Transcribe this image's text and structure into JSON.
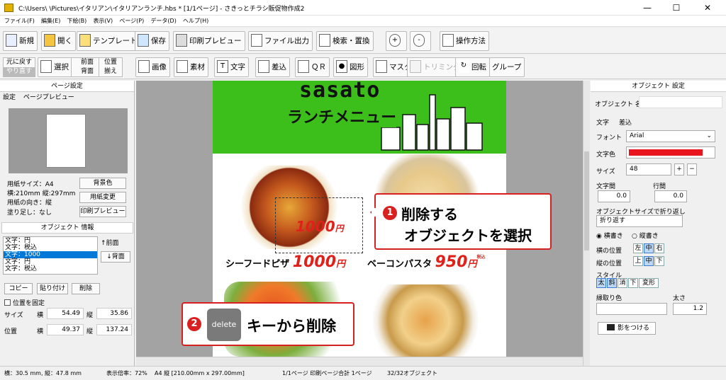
{
  "window": {
    "title": "C:\\Users\\          \\Pictures\\イタリアン\\イタリアンランチ.hbs *  [1/1ページ] - さきっとチラシ販促物作成2"
  },
  "menu": [
    "ファイル(F)",
    "編集(E)",
    "下絵(B)",
    "表示(V)",
    "ページ(P)",
    "データ(D)",
    "ヘルプ(H)"
  ],
  "toolbar1": {
    "new": "新規",
    "open": "開く",
    "template": "テンプレート",
    "save": "保存",
    "print_preview": "印刷プレビュー",
    "file_output": "ファイル出力",
    "search_replace": "検索・置換",
    "zoom_in": "+",
    "zoom_out": "-",
    "help": "操作方法"
  },
  "toolbar2": {
    "undo": "元に戻す",
    "redo": "やり直す",
    "select": "選択",
    "front": "前面",
    "back": "背面",
    "position": "位置",
    "align": "揃え",
    "image": "画像",
    "material": "素材",
    "text": "文字",
    "insert": "差込",
    "qr": "ＱＲ",
    "shape": "図形",
    "mask": "マスク",
    "trim": "トリミング",
    "rotate": "回転",
    "group": "グループ"
  },
  "left": {
    "page_settings": "ページ設定",
    "tab_settings": "設定",
    "tab_preview": "ページプレビュー",
    "paper_size": "用紙サイズ：A4",
    "dims": "横:210mm 縦:297mm",
    "orientation": "用紙の向き：縦",
    "bleed": "塗り足し：なし",
    "bg_color": "背景色",
    "change_paper": "用紙変更",
    "print_preview": "印刷プレビュー",
    "obj_info": "オブジェクト 情報",
    "objects": [
      "文字：円",
      "文字：税込",
      "文字：1000",
      "文字：円",
      "文字：税込"
    ],
    "front": "↑前面",
    "back": "↓背面",
    "copy": "コピー",
    "paste": "貼り付け",
    "delete": "削除",
    "fix_position": "位置を固定",
    "size_label": "サイズ",
    "pos_label": "位置",
    "w_label": "横",
    "h_label": "縦",
    "size_w": "54.49",
    "size_h": "35.86",
    "pos_x": "49.37",
    "pos_y": "137.24"
  },
  "canvas": {
    "brand": "sasato",
    "subtitle": "ランチメニュー",
    "item1": "シーフードピザ",
    "price1": "1000",
    "item2": "ベーコンパスタ",
    "price2": "950",
    "unit": "円",
    "tax": "税込",
    "selected_price": "1000",
    "selected_unit": "円"
  },
  "callouts": {
    "step1_num": "1",
    "step1_line1": "削除する",
    "step1_line2": "オブジェクトを選択",
    "step2_num": "2",
    "step2_key": "delete",
    "step2_text": "キーから削除"
  },
  "right": {
    "header": "オブジェクト 設定",
    "obj_name": "オブジェクト 名",
    "tab_text": "文字",
    "tab_insert": "差込",
    "font_label": "フォント",
    "font_value": "Arial",
    "color_label": "文字色",
    "color_value": "#e8141e",
    "size_label": "サイズ",
    "size_value": "48",
    "char_spacing": "文字間",
    "line_spacing": "行間",
    "char_spacing_val": "0.0",
    "line_spacing_val": "0.0",
    "fit_label": "オブジェクトサイズで折り返し",
    "fit_value": "折り返す",
    "horizontal": "横書き",
    "vertical": "縦書き",
    "h_pos": "横の位置",
    "v_pos": "縦の位置",
    "h_opts": [
      "左",
      "中",
      "右"
    ],
    "v_opts": [
      "上",
      "中",
      "下"
    ],
    "style": "スタイル",
    "style_opts": [
      "太",
      "斜",
      "消",
      "下",
      "変形"
    ],
    "outline_color": "縁取り色",
    "thickness": "太さ",
    "thickness_val": "1.2",
    "shadow": "影をつける"
  },
  "status": {
    "coords": "横：30.5 mm, 縦：47.8 mm",
    "zoom": "表示倍率：72%",
    "paper": "A4 縦 [210.00mm x 297.00mm]",
    "pages": "1/1ページ 印刷ページ合計 1ページ",
    "objects": "32/32オブジェクト"
  }
}
